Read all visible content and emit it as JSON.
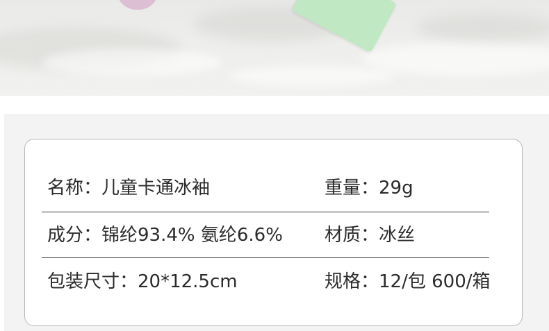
{
  "specs": {
    "row1": {
      "left": "名称：儿童卡通冰袖",
      "right": "重量：29g"
    },
    "row2": {
      "left": "成分：锦纶93.4% 氨纶6.6%",
      "right": "材质：冰丝"
    },
    "row3": {
      "left": "包装尺寸：20*12.5cm",
      "right": "规格：12/包 600/箱"
    }
  },
  "colors": {
    "text": "#2b2b2b",
    "card_border": "#b7b7b7",
    "panel_bg": "#f3f3f3",
    "item_pink": "#d9b7cf",
    "item_green": "#bfe8c3"
  }
}
